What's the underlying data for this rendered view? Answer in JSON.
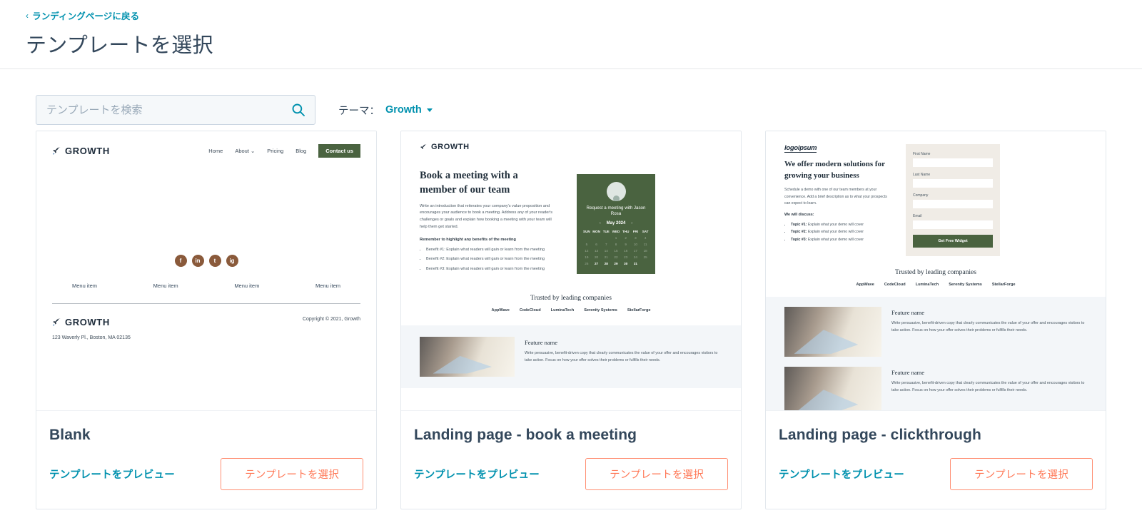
{
  "header": {
    "back_chevron": "‹",
    "back_label": "ランディングページに戻る",
    "title": "テンプレートを選択"
  },
  "toolbar": {
    "search_placeholder": "テンプレートを検索",
    "search_value": "",
    "search_icon": "search-icon",
    "theme_label": "テーマ：",
    "theme_value": "Growth"
  },
  "card_actions": {
    "preview_label": "テンプレートをプレビュー",
    "select_label": "テンプレートを選択"
  },
  "colors": {
    "link": "#0091ae",
    "title": "#33475b",
    "accent_button": "#ff7a59",
    "accent_button_border": "#ff8f73",
    "template_green": "#4a6340",
    "social_brown": "#8a5a3b"
  },
  "cards": [
    {
      "title": "Blank",
      "preview": {
        "logo": "GROWTH",
        "nav": [
          "Home",
          "About ⌄",
          "Pricing",
          "Blog"
        ],
        "cta": "Contact us",
        "social": [
          "f",
          "in",
          "t",
          "ig"
        ],
        "menu_items": [
          "Menu item",
          "Menu item",
          "Menu item",
          "Menu item"
        ],
        "footer_logo": "GROWTH",
        "copyright": "Copyright © 2021, Growth",
        "address": "123 Waverly Pl., Boston, MA 02135"
      }
    },
    {
      "title": "Landing page - book a meeting",
      "preview": {
        "logo": "GROWTH",
        "heading": "Book a meeting with a member of our team",
        "paragraph": "Write an introduction that reiterates your company's value proposition and encourages your audience to book a meeting. Address any of your reader's challenges or goals and explain how booking a meeting with your team will help them get started.",
        "benefits_lead": "Remember to highlight any benefits of the meeting",
        "benefits": [
          "Benefit #1: Explain what readers will gain or learn from the meeting",
          "Benefit #2: Explain what readers will gain or learn from the meeting",
          "Benefit #3: Explain what readers will gain or learn from the meeting"
        ],
        "calendar": {
          "title": "Request a meeting with Jason Rosa",
          "month": "May 2024",
          "prev": "‹",
          "next": "›",
          "dow": [
            "SUN",
            "MON",
            "TUE",
            "WED",
            "THU",
            "FRI",
            "SAT"
          ],
          "weeks": [
            [
              "",
              "",
              "",
              "1",
              "2",
              "3",
              "4"
            ],
            [
              "5",
              "6",
              "7",
              "8",
              "9",
              "10",
              "11"
            ],
            [
              "12",
              "13",
              "14",
              "15",
              "16",
              "17",
              "18"
            ],
            [
              "19",
              "20",
              "21",
              "22",
              "23",
              "24",
              "25"
            ],
            [
              "26",
              "27",
              "28",
              "29",
              "30",
              "31",
              ""
            ]
          ],
          "active_days": [
            "27",
            "28",
            "29",
            "30",
            "31"
          ]
        },
        "trusted_heading": "Trusted by leading companies",
        "trusted_logos": [
          "AppWave",
          "CodeCloud",
          "LuminaTech",
          "Serenity Systems",
          "StellarForge"
        ],
        "feature_heading": "Feature name",
        "feature_paragraph": "Write persuasive, benefit-driven copy that clearly communicates the value of your offer and encourages visitors to take action. Focus on how your offer solves their problems or fulfills their needs."
      }
    },
    {
      "title": "Landing page - clickthrough",
      "preview": {
        "logo": "logoipsum",
        "heading": "We offer modern solutions for growing your business",
        "paragraph": "Schedule a demo with one of our team members at your convenience. Add a brief description as to what your prospects can expect to learn.",
        "topics_lead": "We will discuss:",
        "topics": [
          {
            "label": "Topic #1:",
            "text": " Explain what your demo will cover"
          },
          {
            "label": "Topic #2:",
            "text": " Explain what your demo will cover"
          },
          {
            "label": "Topic #3:",
            "text": " Explain what your demo will cover"
          }
        ],
        "form": {
          "fields": [
            "First Name",
            "Last Name",
            "Company",
            "Email"
          ],
          "submit": "Get Free Widget"
        },
        "trusted_heading": "Trusted by leading companies",
        "trusted_logos": [
          "AppWave",
          "CodeCloud",
          "LuminaTech",
          "Serenity Systems",
          "StellarForge"
        ],
        "features": [
          {
            "heading": "Feature name",
            "paragraph": "Write persuasive, benefit-driven copy that clearly communicates the value of your offer and encourages visitors to take action. Focus on how your offer solves their problems or fulfills their needs."
          },
          {
            "heading": "Feature name",
            "paragraph": "Write persuasive, benefit-driven copy that clearly communicates the value of your offer and encourages visitors to take action. Focus on how your offer solves their problems or fulfills their needs."
          }
        ]
      }
    }
  ]
}
